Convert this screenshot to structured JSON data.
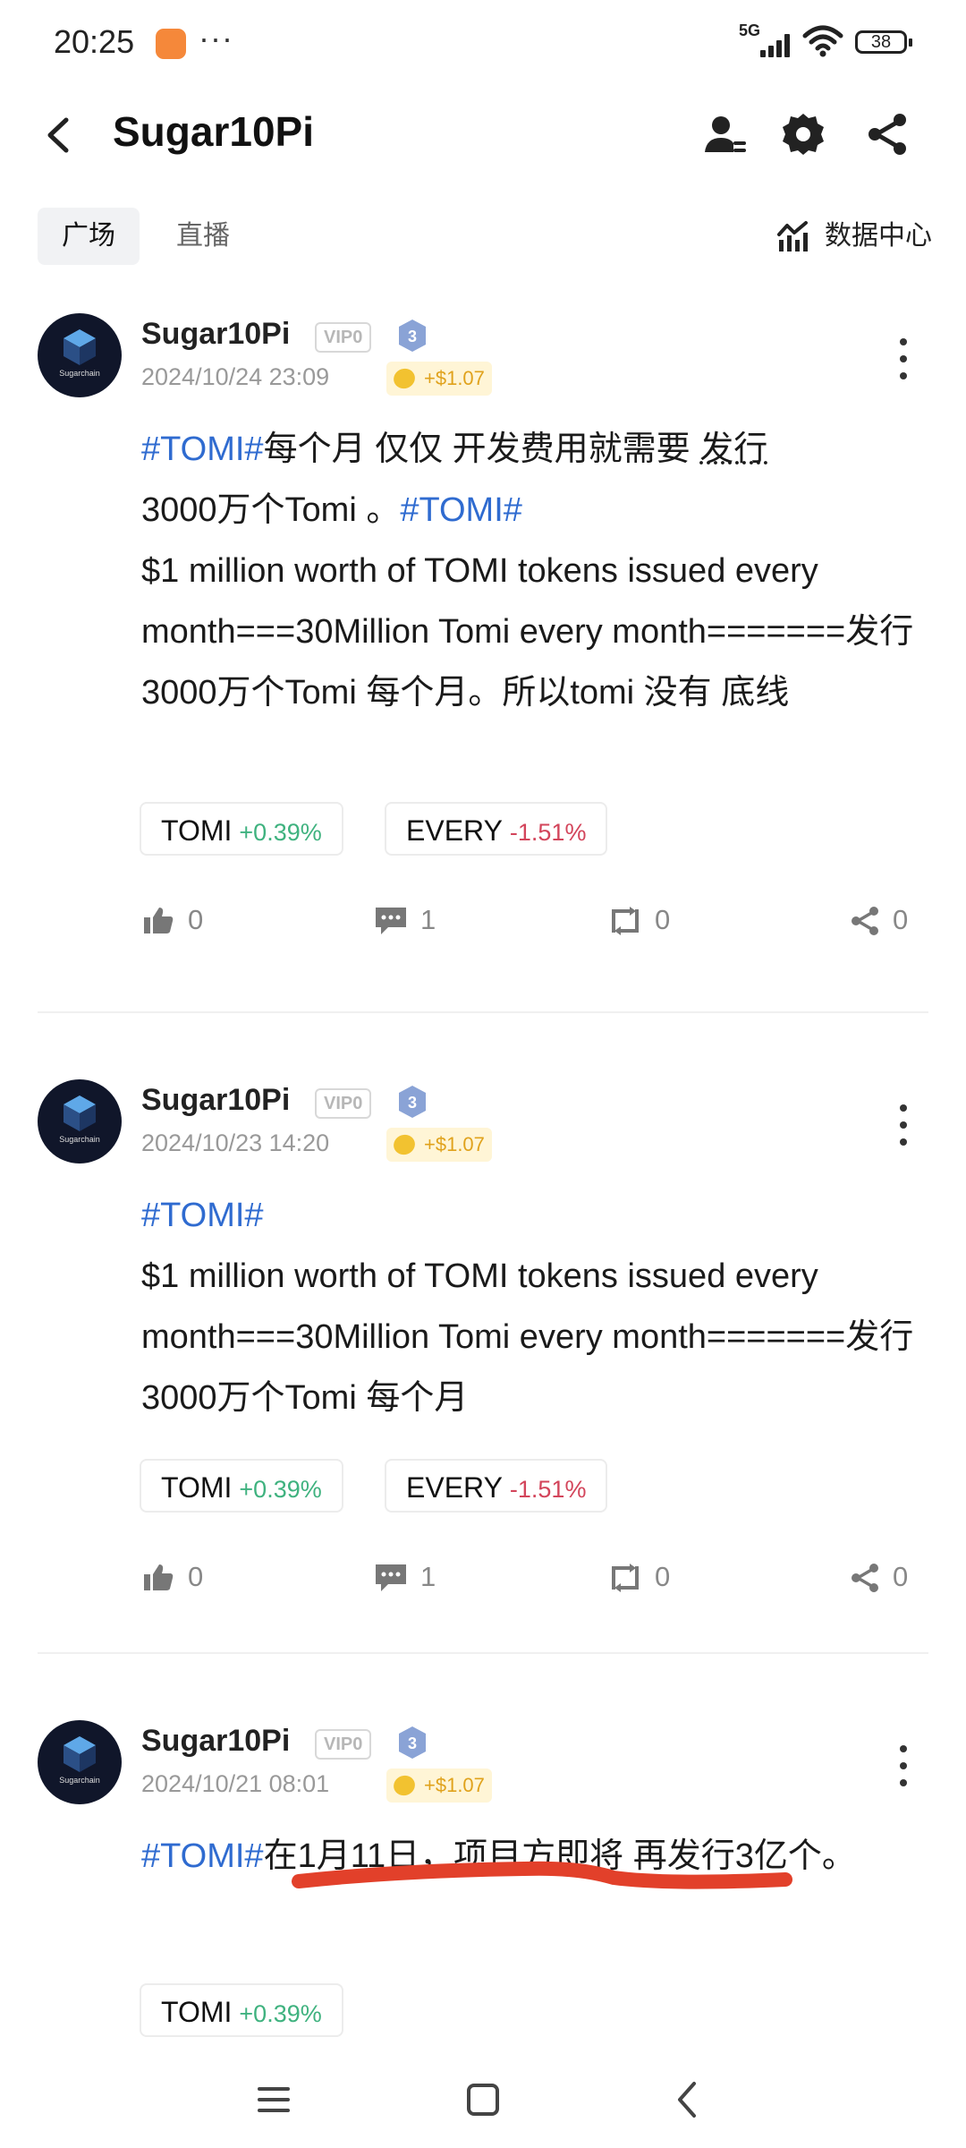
{
  "status_bar": {
    "time": "20:25",
    "dots": "···",
    "signal": "5G",
    "battery": "38"
  },
  "header": {
    "title": "Sugar10Pi"
  },
  "tabs": [
    {
      "label": "广场"
    },
    {
      "label": "直播"
    }
  ],
  "data_center": {
    "label": "数据中心"
  },
  "posts": [
    {
      "user": "Sugar10Pi",
      "vip": "VIP0",
      "level": "3",
      "date": "2024/10/24 23:09",
      "earn": "+$1.07",
      "content": {
        "tag1": "#TOMI#",
        "line1": "每个月 仅仅 开发费用就需要 ",
        "line1_ul": "发行",
        "line2": "3000万个Tomi 。",
        "tag2": "#TOMI#",
        "body": "$1 million worth of TOMI tokens issued every month===30Million Tomi every month=======发行3000万个Tomi 每个月。所以tomi 没有 底线"
      },
      "chips": [
        {
          "name": "TOMI",
          "change": "+0.39%"
        },
        {
          "name": "EVERY",
          "change": "-1.51%"
        }
      ],
      "actions": {
        "like": "0",
        "comment": "1",
        "repost": "0",
        "share": "0"
      }
    },
    {
      "user": "Sugar10Pi",
      "vip": "VIP0",
      "level": "3",
      "date": "2024/10/23 14:20",
      "earn": "+$1.07",
      "content": {
        "tag1": "#TOMI#",
        "body": "$1 million worth of TOMI tokens issued every month===30Million Tomi every month=======发行3000万个Tomi 每个月"
      },
      "chips": [
        {
          "name": "TOMI",
          "change": "+0.39%"
        },
        {
          "name": "EVERY",
          "change": "-1.51%"
        }
      ],
      "actions": {
        "like": "0",
        "comment": "1",
        "repost": "0",
        "share": "0"
      }
    },
    {
      "user": "Sugar10Pi",
      "vip": "VIP0",
      "level": "3",
      "date": "2024/10/21 08:01",
      "earn": "+$1.07",
      "content": {
        "tag1": "#TOMI#",
        "body": "在1月11日，项目方即将 再发行3亿个。"
      },
      "chips": [
        {
          "name": "TOMI",
          "change": "+0.39%"
        }
      ]
    }
  ],
  "colors": {
    "tag": "#2f6bd0",
    "positive": "#3fb27f",
    "negative": "#d3455b",
    "annotation": "#e2402a"
  }
}
